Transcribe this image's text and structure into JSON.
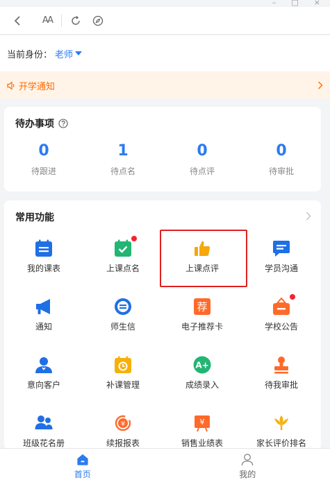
{
  "window": {
    "minimize": "–",
    "restore": "□",
    "close": "×"
  },
  "toolbar": {
    "back_icon": "chevron-left-icon",
    "font_icon": "font-size-icon",
    "font_text": "AA",
    "refresh_icon": "refresh-icon",
    "compass_icon": "compass-icon"
  },
  "identity": {
    "label": "当前身份：",
    "value": "老师"
  },
  "notice": {
    "text": "开学通知"
  },
  "todo": {
    "title": "待办事项",
    "items": [
      {
        "count": "0",
        "label": "待跟进"
      },
      {
        "count": "1",
        "label": "待点名"
      },
      {
        "count": "0",
        "label": "待点评"
      },
      {
        "count": "0",
        "label": "待审批"
      }
    ]
  },
  "functions": {
    "title": "常用功能",
    "items": [
      {
        "label": "我的课表",
        "icon": "schedule-icon"
      },
      {
        "label": "上课点名",
        "icon": "checkin-calendar-icon"
      },
      {
        "label": "上课点评",
        "icon": "thumbs-up-icon"
      },
      {
        "label": "学员沟通",
        "icon": "chat-icon"
      },
      {
        "label": "通知",
        "icon": "megaphone-icon"
      },
      {
        "label": "师生信",
        "icon": "message-circle-icon"
      },
      {
        "label": "电子推荐卡",
        "icon": "recommend-card-icon",
        "glyph": "荐"
      },
      {
        "label": "学校公告",
        "icon": "announcement-icon"
      },
      {
        "label": "意向客户",
        "icon": "customer-icon"
      },
      {
        "label": "补课管理",
        "icon": "makeup-class-icon"
      },
      {
        "label": "成绩录入",
        "icon": "grade-entry-icon",
        "glyph": "A+"
      },
      {
        "label": "待我审批",
        "icon": "stamp-icon"
      },
      {
        "label": "班级花名册",
        "icon": "roster-icon"
      },
      {
        "label": "续报报表",
        "icon": "renewal-report-icon",
        "glyph": "¥"
      },
      {
        "label": "销售业绩表",
        "icon": "sales-report-icon",
        "glyph": "¥"
      },
      {
        "label": "家长评价排名",
        "icon": "ranking-icon"
      }
    ]
  },
  "bottombar": {
    "tabs": [
      {
        "label": "首页",
        "icon": "home-icon"
      },
      {
        "label": "我的",
        "icon": "user-icon"
      }
    ]
  },
  "colors": {
    "accent": "#2b7bef",
    "notice": "#ff6a00",
    "notice_bg": "#fff4e7",
    "badge": "#f5222d"
  }
}
